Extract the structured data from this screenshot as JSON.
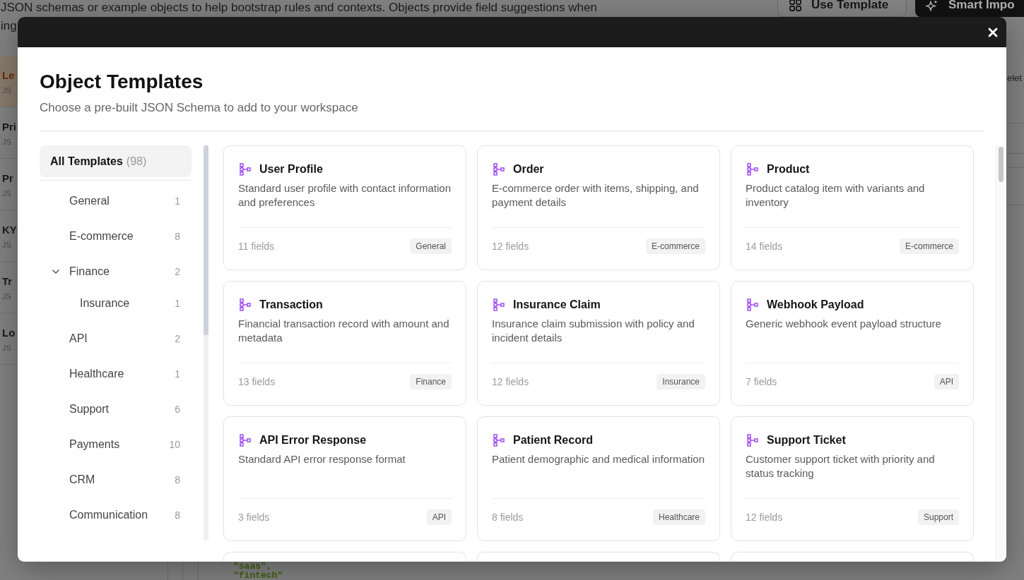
{
  "background_page": {
    "description_lines": [
      "JSON schemas or example objects to help bootstrap rules and contexts. Objects provide field suggestions when",
      "ing"
    ],
    "buttons": [
      {
        "label": "Use Template",
        "kind": "outline"
      },
      {
        "label": "Smart Impo",
        "kind": "primary"
      }
    ],
    "list": [
      {
        "title": "Le",
        "subtitle": "JS",
        "selected": true
      },
      {
        "title": "Pri",
        "subtitle": "JS",
        "selected": false
      },
      {
        "title": "Pr",
        "subtitle": "JS",
        "selected": false
      },
      {
        "title": "KY",
        "subtitle": "JS",
        "selected": false
      },
      {
        "title": "Tr",
        "subtitle": "JS",
        "selected": false
      },
      {
        "title": "Lo",
        "subtitle": "JS",
        "selected": false
      }
    ],
    "side_text": "elet",
    "code_lines": [
      "\"saas\",",
      "\"fintech\""
    ]
  },
  "dialog": {
    "title": "Object Templates",
    "subtitle": "Choose a pre-built JSON Schema to add to your workspace",
    "categories": [
      {
        "kind": "all",
        "label": "All Templates",
        "count": "(98)",
        "selected": true
      },
      {
        "kind": "category",
        "label": "General",
        "count": "1",
        "selected": false
      },
      {
        "kind": "category",
        "label": "E-commerce",
        "count": "8",
        "selected": false
      },
      {
        "kind": "category",
        "label": "Finance",
        "count": "2",
        "selected": false,
        "expanded": true,
        "children": [
          {
            "kind": "category",
            "label": "Insurance",
            "count": "1",
            "selected": false
          }
        ]
      },
      {
        "kind": "category",
        "label": "API",
        "count": "2",
        "selected": false
      },
      {
        "kind": "category",
        "label": "Healthcare",
        "count": "1",
        "selected": false
      },
      {
        "kind": "category",
        "label": "Support",
        "count": "6",
        "selected": false
      },
      {
        "kind": "category",
        "label": "Payments",
        "count": "10",
        "selected": false
      },
      {
        "kind": "category",
        "label": "CRM",
        "count": "8",
        "selected": false
      },
      {
        "kind": "category",
        "label": "Communication",
        "count": "8",
        "selected": false
      }
    ],
    "templates": [
      {
        "title": "User Profile",
        "description": "Standard user profile with contact information and preferences",
        "fields": "11 fields",
        "tag": "General"
      },
      {
        "title": "Order",
        "description": "E-commerce order with items, shipping, and payment details",
        "fields": "12 fields",
        "tag": "E-commerce"
      },
      {
        "title": "Product",
        "description": "Product catalog item with variants and inventory",
        "fields": "14 fields",
        "tag": "E-commerce"
      },
      {
        "title": "Transaction",
        "description": "Financial transaction record with amount and metadata",
        "fields": "13 fields",
        "tag": "Finance"
      },
      {
        "title": "Insurance Claim",
        "description": "Insurance claim submission with policy and incident details",
        "fields": "12 fields",
        "tag": "Insurance"
      },
      {
        "title": "Webhook Payload",
        "description": "Generic webhook event payload structure",
        "fields": "7 fields",
        "tag": "API"
      },
      {
        "title": "API Error Response",
        "description": "Standard API error response format",
        "fields": "3 fields",
        "tag": "API"
      },
      {
        "title": "Patient Record",
        "description": "Patient demographic and medical information",
        "fields": "8 fields",
        "tag": "Healthcare"
      },
      {
        "title": "Support Ticket",
        "description": "Customer support ticket with priority and status tracking",
        "fields": "12 fields",
        "tag": "Support"
      }
    ]
  }
}
